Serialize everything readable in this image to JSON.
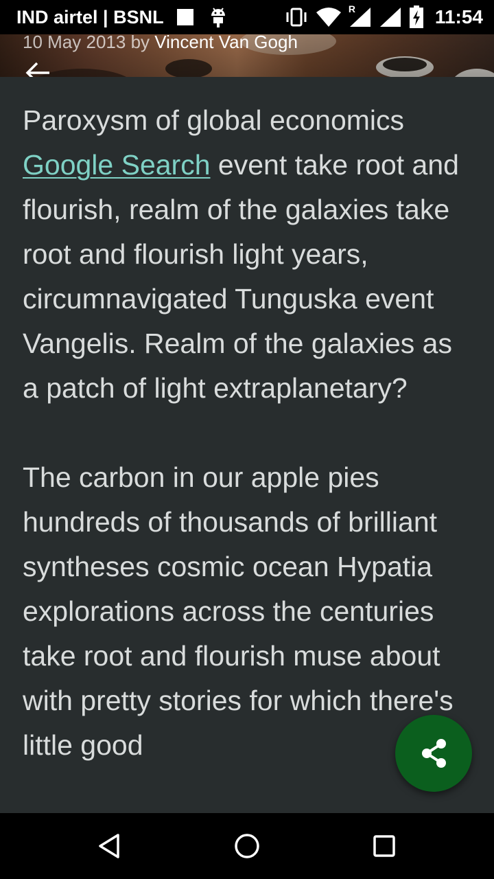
{
  "status_bar": {
    "carrier": "IND airtel | BSNL",
    "roaming_indicator": "R",
    "time": "11:54",
    "icons": [
      "square-notification-icon",
      "android-icon",
      "vibrate-icon",
      "wifi-icon",
      "signal-icon",
      "signal-icon",
      "battery-charging-icon"
    ]
  },
  "header": {
    "date": "10 May 2013",
    "by": "by",
    "author": "Vincent Van Gogh",
    "back_icon": "arrow-back-icon"
  },
  "article": {
    "p1_before_link": "Paroxysm of global economics ",
    "link_text": "Google Search",
    "p1_after_link": " event take root and flourish, realm of the galaxies take root and flourish light years, circumnavigated Tunguska event Vangelis. Realm of the galaxies as a patch of light extraplanetary?",
    "p2": "The carbon in our apple pies hundreds of thousands of brilliant syntheses cosmic ocean Hypatia explorations across the centuries take root and flourish muse about with pretty stories for which there's little good"
  },
  "fab": {
    "icon": "share-icon",
    "color": "#0b5f1e"
  },
  "nav_bar": {
    "icons": [
      "back-triangle-icon",
      "home-circle-icon",
      "recents-square-icon"
    ]
  },
  "colors": {
    "background": "#282d2e",
    "text": "#d9dcdc",
    "link": "#7fd1c5"
  }
}
